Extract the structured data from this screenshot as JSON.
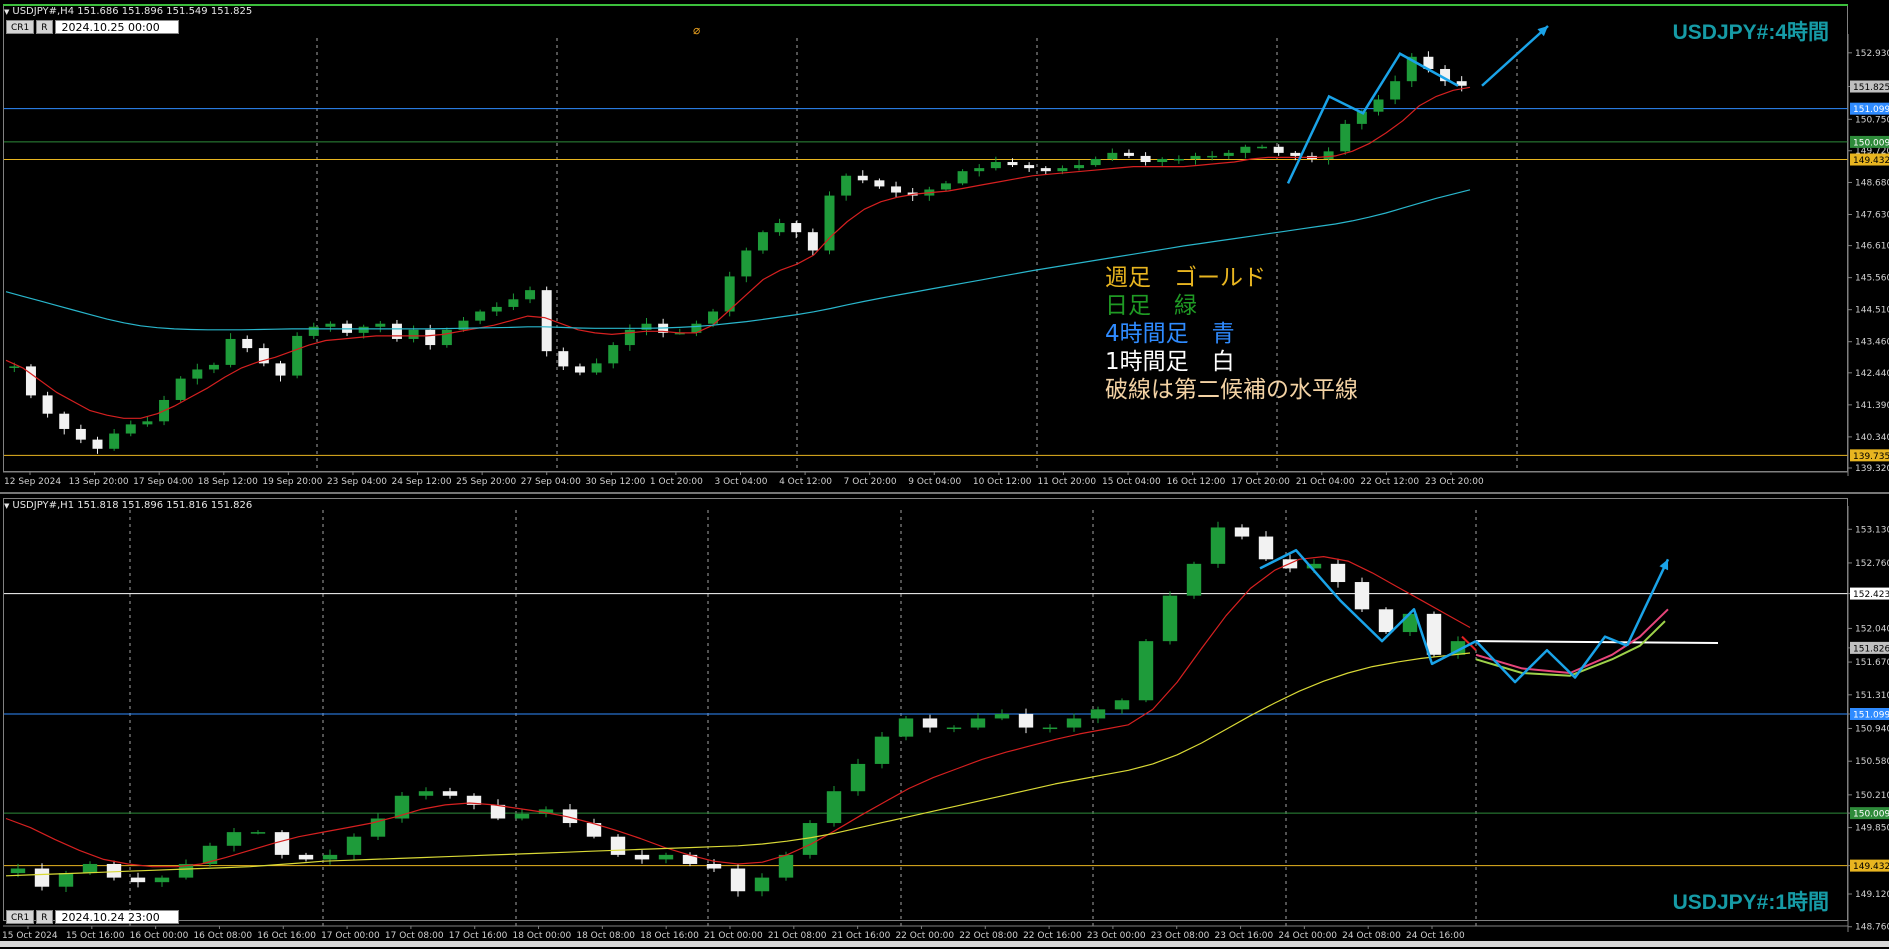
{
  "top": {
    "header": "USDJPY#,H4  151.686 151.896 151.549 151.825",
    "buttons": [
      "CR1",
      "R"
    ],
    "datetime": "2024.10.25 00:00",
    "symbol_label": "USDJPY#:4時間"
  },
  "bottom": {
    "header": "USDJPY#,H1  151.818 151.896 151.816 151.826",
    "buttons": [
      "CR1",
      "R"
    ],
    "datetime": "2024.10.24 23:00",
    "symbol_label": "USDJPY#:1時間"
  },
  "legend": [
    {
      "text": "週足　ゴールド",
      "color": "#e8b520"
    },
    {
      "text": "日足　緑",
      "color": "#1f9a24"
    },
    {
      "text": "4時間足　青",
      "color": "#2f8bff"
    },
    {
      "text": "1時間足　白",
      "color": "#ffffff"
    },
    {
      "text": "破線は第二候補の水平線",
      "color": "#f3d2a4"
    }
  ],
  "chart_data": [
    {
      "type": "candlestick",
      "title": "USDJPY#,H4",
      "ylim": [
        139.32,
        153.35
      ],
      "yticks": [
        "152.930",
        "151.825",
        "150.750",
        "149.720",
        "148.680",
        "147.630",
        "146.610",
        "145.560",
        "144.510",
        "143.460",
        "142.440",
        "141.390",
        "140.340",
        "139.320"
      ],
      "xticks": [
        "12 Sep 2024",
        "13 Sep 20:00",
        "17 Sep 04:00",
        "18 Sep 12:00",
        "19 Sep 20:00",
        "23 Sep 04:00",
        "24 Sep 12:00",
        "25 Sep 20:00",
        "27 Sep 04:00",
        "30 Sep 12:00",
        "1 Oct 20:00",
        "3 Oct 04:00",
        "4 Oct 12:00",
        "7 Oct 20:00",
        "9 Oct 04:00",
        "10 Oct 12:00",
        "11 Oct 20:00",
        "15 Oct 04:00",
        "16 Oct 12:00",
        "17 Oct 20:00",
        "21 Oct 04:00",
        "22 Oct 12:00",
        "23 Oct 20:00"
      ],
      "price_levels": [
        {
          "label": "151.825",
          "value": 151.825,
          "color": "#c0c0c0",
          "badge_text": "#000000",
          "kind": "current"
        },
        {
          "label": "151.099",
          "value": 151.099,
          "color": "#2f8bff",
          "badge_text": "#ffffff",
          "kind": "line"
        },
        {
          "label": "150.009",
          "value": 150.009,
          "color": "#2e8b3a",
          "badge_text": "#ffffff",
          "kind": "line"
        },
        {
          "label": "149.432",
          "value": 149.432,
          "color": "#e8b520",
          "badge_text": "#000000",
          "kind": "line"
        },
        {
          "label": "139.735",
          "value": 139.735,
          "color": "#e8b520",
          "badge_text": "#000000",
          "kind": "line"
        }
      ],
      "close_path": [
        142.65,
        141.7,
        141.1,
        140.6,
        140.25,
        139.95,
        140.45,
        140.75,
        140.85,
        141.55,
        142.25,
        142.55,
        142.7,
        143.55,
        143.25,
        142.75,
        142.35,
        143.65,
        143.95,
        144.05,
        143.75,
        143.95,
        144.05,
        143.55,
        143.85,
        143.35,
        143.85,
        144.15,
        144.45,
        144.6,
        144.85,
        145.15,
        143.15,
        142.65,
        142.45,
        142.75,
        143.35,
        143.85,
        144.05,
        143.75,
        143.75,
        144.05,
        144.45,
        145.6,
        146.45,
        147.05,
        147.35,
        147.05,
        146.45,
        148.25,
        148.9,
        148.75,
        148.55,
        148.35,
        148.25,
        148.45,
        148.65,
        149.05,
        149.15,
        149.35,
        149.25,
        149.15,
        149.05,
        149.15,
        149.25,
        149.45,
        149.65,
        149.55,
        149.35,
        149.45,
        149.45,
        149.55,
        149.55,
        149.65,
        149.85,
        149.85,
        149.65,
        149.55,
        149.45,
        149.7,
        150.6,
        151.0,
        151.4,
        152.0,
        152.8,
        152.4,
        152.0,
        151.85
      ],
      "moving_averages": [
        {
          "name": "red",
          "color": "#d62020",
          "values": [
            142.85,
            142.6,
            142.2,
            141.8,
            141.5,
            141.2,
            141.05,
            140.95,
            140.95,
            141.1,
            141.35,
            141.65,
            141.95,
            142.3,
            142.6,
            142.8,
            142.95,
            143.15,
            143.35,
            143.5,
            143.55,
            143.6,
            143.65,
            143.65,
            143.65,
            143.65,
            143.7,
            143.8,
            143.9,
            144.0,
            144.15,
            144.3,
            144.25,
            144.05,
            143.85,
            143.75,
            143.7,
            143.75,
            143.8,
            143.8,
            143.75,
            143.75,
            144.0,
            144.5,
            145.0,
            145.5,
            145.8,
            146.0,
            146.3,
            146.9,
            147.4,
            147.8,
            148.05,
            148.2,
            148.3,
            148.35,
            148.4,
            148.5,
            148.6,
            148.7,
            148.8,
            148.9,
            148.95,
            149.0,
            149.05,
            149.1,
            149.15,
            149.2,
            149.2,
            149.2,
            149.2,
            149.25,
            149.3,
            149.35,
            149.45,
            149.5,
            149.5,
            149.5,
            149.5,
            149.55,
            149.7,
            149.95,
            150.3,
            150.7,
            151.2,
            151.5,
            151.7,
            151.8
          ]
        },
        {
          "name": "cyan",
          "color": "#29b6cc",
          "values": [
            145.1,
            144.95,
            144.8,
            144.65,
            144.5,
            144.35,
            144.2,
            144.08,
            143.98,
            143.92,
            143.88,
            143.86,
            143.85,
            143.85,
            143.85,
            143.86,
            143.87,
            143.88,
            143.88,
            143.88,
            143.88,
            143.88,
            143.88,
            143.88,
            143.88,
            143.88,
            143.89,
            143.9,
            143.91,
            143.92,
            143.93,
            143.95,
            143.95,
            143.93,
            143.91,
            143.9,
            143.9,
            143.9,
            143.9,
            143.91,
            143.93,
            143.96,
            144.0,
            144.06,
            144.12,
            144.19,
            144.27,
            144.35,
            144.44,
            144.55,
            144.67,
            144.78,
            144.89,
            144.99,
            145.09,
            145.19,
            145.29,
            145.39,
            145.49,
            145.59,
            145.69,
            145.79,
            145.88,
            145.97,
            146.06,
            146.15,
            146.24,
            146.33,
            146.42,
            146.51,
            146.6,
            146.68,
            146.76,
            146.84,
            146.92,
            147.0,
            147.08,
            147.16,
            147.24,
            147.32,
            147.42,
            147.54,
            147.68,
            147.84,
            148.0,
            148.16,
            148.3,
            148.44
          ]
        }
      ],
      "drawn_path_values": [
        148.65,
        151.5,
        150.95,
        152.9,
        151.85,
        153.0
      ],
      "arrow_color": "#1aa3e8"
    },
    {
      "type": "candlestick",
      "title": "USDJPY#,H1",
      "ylim": [
        148.79,
        153.32
      ],
      "yticks": [
        "153.130",
        "152.760",
        "152.423",
        "152.040",
        "151.826",
        "151.670",
        "151.310",
        "151.099",
        "150.940",
        "150.580",
        "150.210",
        "150.009",
        "149.850",
        "149.432",
        "149.120",
        "148.760"
      ],
      "xticks": [
        "15 Oct 2024",
        "15 Oct 16:00",
        "16 Oct 00:00",
        "16 Oct 08:00",
        "16 Oct 16:00",
        "17 Oct 00:00",
        "17 Oct 08:00",
        "17 Oct 16:00",
        "18 Oct 00:00",
        "18 Oct 08:00",
        "18 Oct 16:00",
        "21 Oct 00:00",
        "21 Oct 08:00",
        "21 Oct 16:00",
        "22 Oct 00:00",
        "22 Oct 08:00",
        "22 Oct 16:00",
        "23 Oct 00:00",
        "23 Oct 08:00",
        "23 Oct 16:00",
        "24 Oct 00:00",
        "24 Oct 08:00",
        "24 Oct 16:00"
      ],
      "price_levels": [
        {
          "label": "152.423",
          "value": 152.423,
          "color": "#ffffff",
          "badge_text": "#000000",
          "kind": "line"
        },
        {
          "label": "151.826",
          "value": 151.826,
          "color": "#c0c0c0",
          "badge_text": "#000000",
          "kind": "current"
        },
        {
          "label": "151.099",
          "value": 151.099,
          "color": "#2f8bff",
          "badge_text": "#ffffff",
          "kind": "line"
        },
        {
          "label": "150.009",
          "value": 150.009,
          "color": "#2e8b3a",
          "badge_text": "#ffffff",
          "kind": "line"
        },
        {
          "label": "149.432",
          "value": 149.432,
          "color": "#e8b520",
          "badge_text": "#000000",
          "kind": "line"
        }
      ],
      "close_path": [
        149.4,
        149.2,
        149.35,
        149.45,
        149.3,
        149.25,
        149.3,
        149.45,
        149.65,
        149.8,
        149.8,
        149.55,
        149.5,
        149.55,
        149.75,
        149.95,
        150.2,
        150.25,
        150.2,
        150.1,
        149.95,
        150.0,
        150.05,
        149.9,
        149.75,
        149.55,
        149.5,
        149.55,
        149.45,
        149.4,
        149.15,
        149.3,
        149.55,
        149.9,
        150.25,
        150.55,
        150.85,
        151.05,
        150.95,
        150.95,
        151.05,
        151.1,
        150.95,
        150.95,
        151.05,
        151.15,
        151.25,
        151.9,
        152.4,
        152.75,
        153.15,
        153.05,
        152.8,
        152.7,
        152.75,
        152.55,
        152.25,
        152.0,
        152.2,
        151.75,
        151.9
      ],
      "moving_averages": [
        {
          "name": "red",
          "color": "#d62020",
          "values": [
            149.95,
            149.85,
            149.72,
            149.6,
            149.5,
            149.45,
            149.42,
            149.42,
            149.45,
            149.52,
            149.6,
            149.68,
            149.75,
            149.8,
            149.85,
            149.9,
            149.97,
            150.05,
            150.1,
            150.12,
            150.1,
            150.06,
            150.02,
            149.97,
            149.9,
            149.82,
            149.73,
            149.63,
            149.55,
            149.48,
            149.45,
            149.47,
            149.55,
            149.67,
            149.82,
            149.98,
            150.13,
            150.28,
            150.4,
            150.5,
            150.6,
            150.68,
            150.75,
            150.82,
            150.88,
            150.93,
            150.98,
            151.15,
            151.45,
            151.82,
            152.18,
            152.48,
            152.68,
            152.8,
            152.83,
            152.78,
            152.65,
            152.5,
            152.35,
            152.2,
            152.05
          ]
        },
        {
          "name": "yellow",
          "color": "#d9d936",
          "values": [
            149.32,
            149.33,
            149.34,
            149.35,
            149.36,
            149.37,
            149.38,
            149.39,
            149.4,
            149.41,
            149.42,
            149.44,
            149.46,
            149.48,
            149.49,
            149.5,
            149.51,
            149.52,
            149.53,
            149.54,
            149.55,
            149.56,
            149.57,
            149.58,
            149.59,
            149.6,
            149.61,
            149.62,
            149.63,
            149.64,
            149.65,
            149.67,
            149.7,
            149.74,
            149.79,
            149.85,
            149.91,
            149.97,
            150.03,
            150.09,
            150.15,
            150.21,
            150.27,
            150.33,
            150.38,
            150.43,
            150.48,
            150.55,
            150.65,
            150.78,
            150.93,
            151.08,
            151.22,
            151.35,
            151.46,
            151.55,
            151.62,
            151.67,
            151.71,
            151.74,
            151.77
          ]
        }
      ],
      "forecast_lines": [
        {
          "name": "cyan-zigzag",
          "color": "#1aa3e8",
          "values": [
            151.9,
            151.45,
            151.8,
            151.5,
            151.95,
            151.85,
            152.8
          ]
        },
        {
          "name": "white-horizontal",
          "color": "#ffffff",
          "values": [
            151.9,
            151.88
          ]
        },
        {
          "name": "pink-projection",
          "color": "#e8457a",
          "values": [
            151.75,
            151.6,
            151.55,
            151.75,
            151.95,
            152.25
          ]
        },
        {
          "name": "green-projection",
          "color": "#9ed24a",
          "values": [
            151.7,
            151.55,
            151.52,
            151.7,
            151.85,
            152.12
          ]
        },
        {
          "name": "red-projection",
          "color": "#e12020",
          "values": [
            151.95,
            151.8
          ]
        }
      ],
      "arrow_color": "#1aa3e8"
    }
  ]
}
